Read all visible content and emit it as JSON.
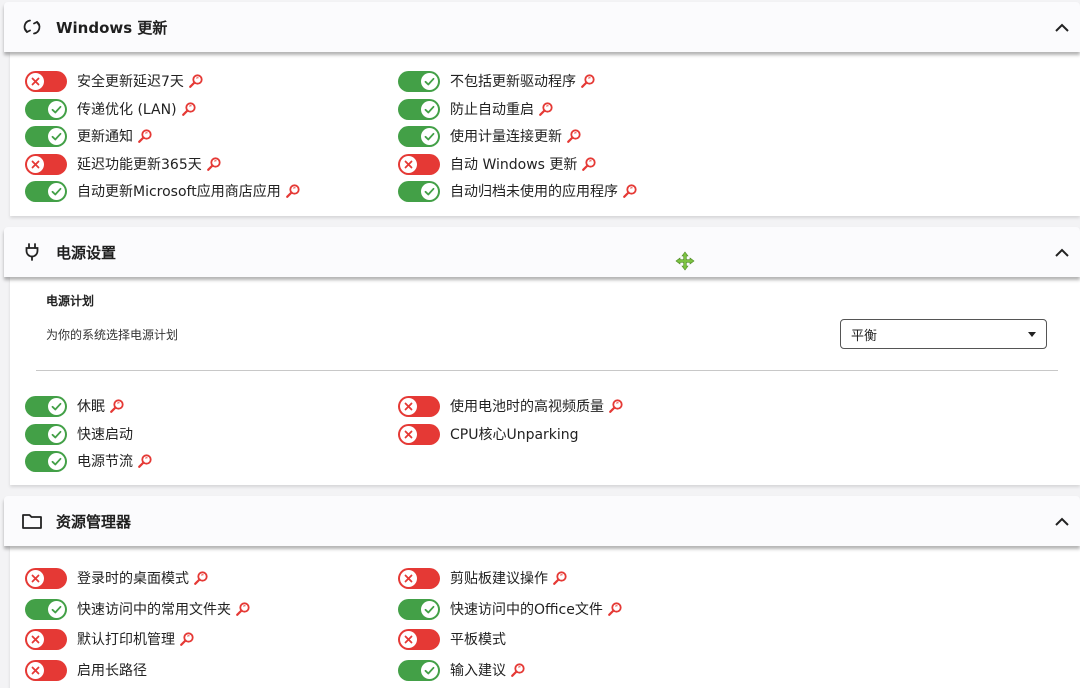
{
  "sections": [
    {
      "title": "Windows 更新",
      "icon": "refresh-icon",
      "left": [
        {
          "label": "安全更新延迟7天",
          "on": false,
          "search": true
        },
        {
          "label": "传递优化 (LAN)",
          "on": true,
          "search": true
        },
        {
          "label": "更新通知",
          "on": true,
          "search": true
        },
        {
          "label": "延迟功能更新365天",
          "on": false,
          "search": true
        },
        {
          "label": "自动更新Microsoft应用商店应用",
          "on": true,
          "search": true
        }
      ],
      "right": [
        {
          "label": "不包括更新驱动程序",
          "on": true,
          "search": true
        },
        {
          "label": "防止自动重启",
          "on": true,
          "search": true
        },
        {
          "label": "使用计量连接更新",
          "on": true,
          "search": true
        },
        {
          "label": "自动 Windows 更新",
          "on": false,
          "search": true
        },
        {
          "label": "自动归档未使用的应用程序",
          "on": true,
          "search": true
        }
      ]
    },
    {
      "title": "电源设置",
      "icon": "plug-icon",
      "plan_title": "电源计划",
      "plan_desc": "为你的系统选择电源计划",
      "plan_value": "平衡",
      "left": [
        {
          "label": "休眠",
          "on": true,
          "search": true
        },
        {
          "label": "快速启动",
          "on": true,
          "search": false
        },
        {
          "label": "电源节流",
          "on": true,
          "search": true
        }
      ],
      "right": [
        {
          "label": "使用电池时的高视频质量",
          "on": false,
          "search": true
        },
        {
          "label": "CPU核心Unparking",
          "on": false,
          "search": false
        }
      ]
    },
    {
      "title": "资源管理器",
      "icon": "folder-icon",
      "left": [
        {
          "label": "登录时的桌面模式",
          "on": false,
          "search": true
        },
        {
          "label": "快速访问中的常用文件夹",
          "on": true,
          "search": true
        },
        {
          "label": "默认打印机管理",
          "on": false,
          "search": true
        },
        {
          "label": "启用长路径",
          "on": false,
          "search": false
        }
      ],
      "right": [
        {
          "label": "剪贴板建议操作",
          "on": false,
          "search": true
        },
        {
          "label": "快速访问中的Office文件",
          "on": true,
          "search": true
        },
        {
          "label": "平板模式",
          "on": false,
          "search": false
        },
        {
          "label": "输入建议",
          "on": true,
          "search": true
        }
      ]
    }
  ],
  "colors": {
    "on": "#43a047",
    "off": "#e53935",
    "search": "#e53935",
    "cursor": "#7cc242"
  }
}
